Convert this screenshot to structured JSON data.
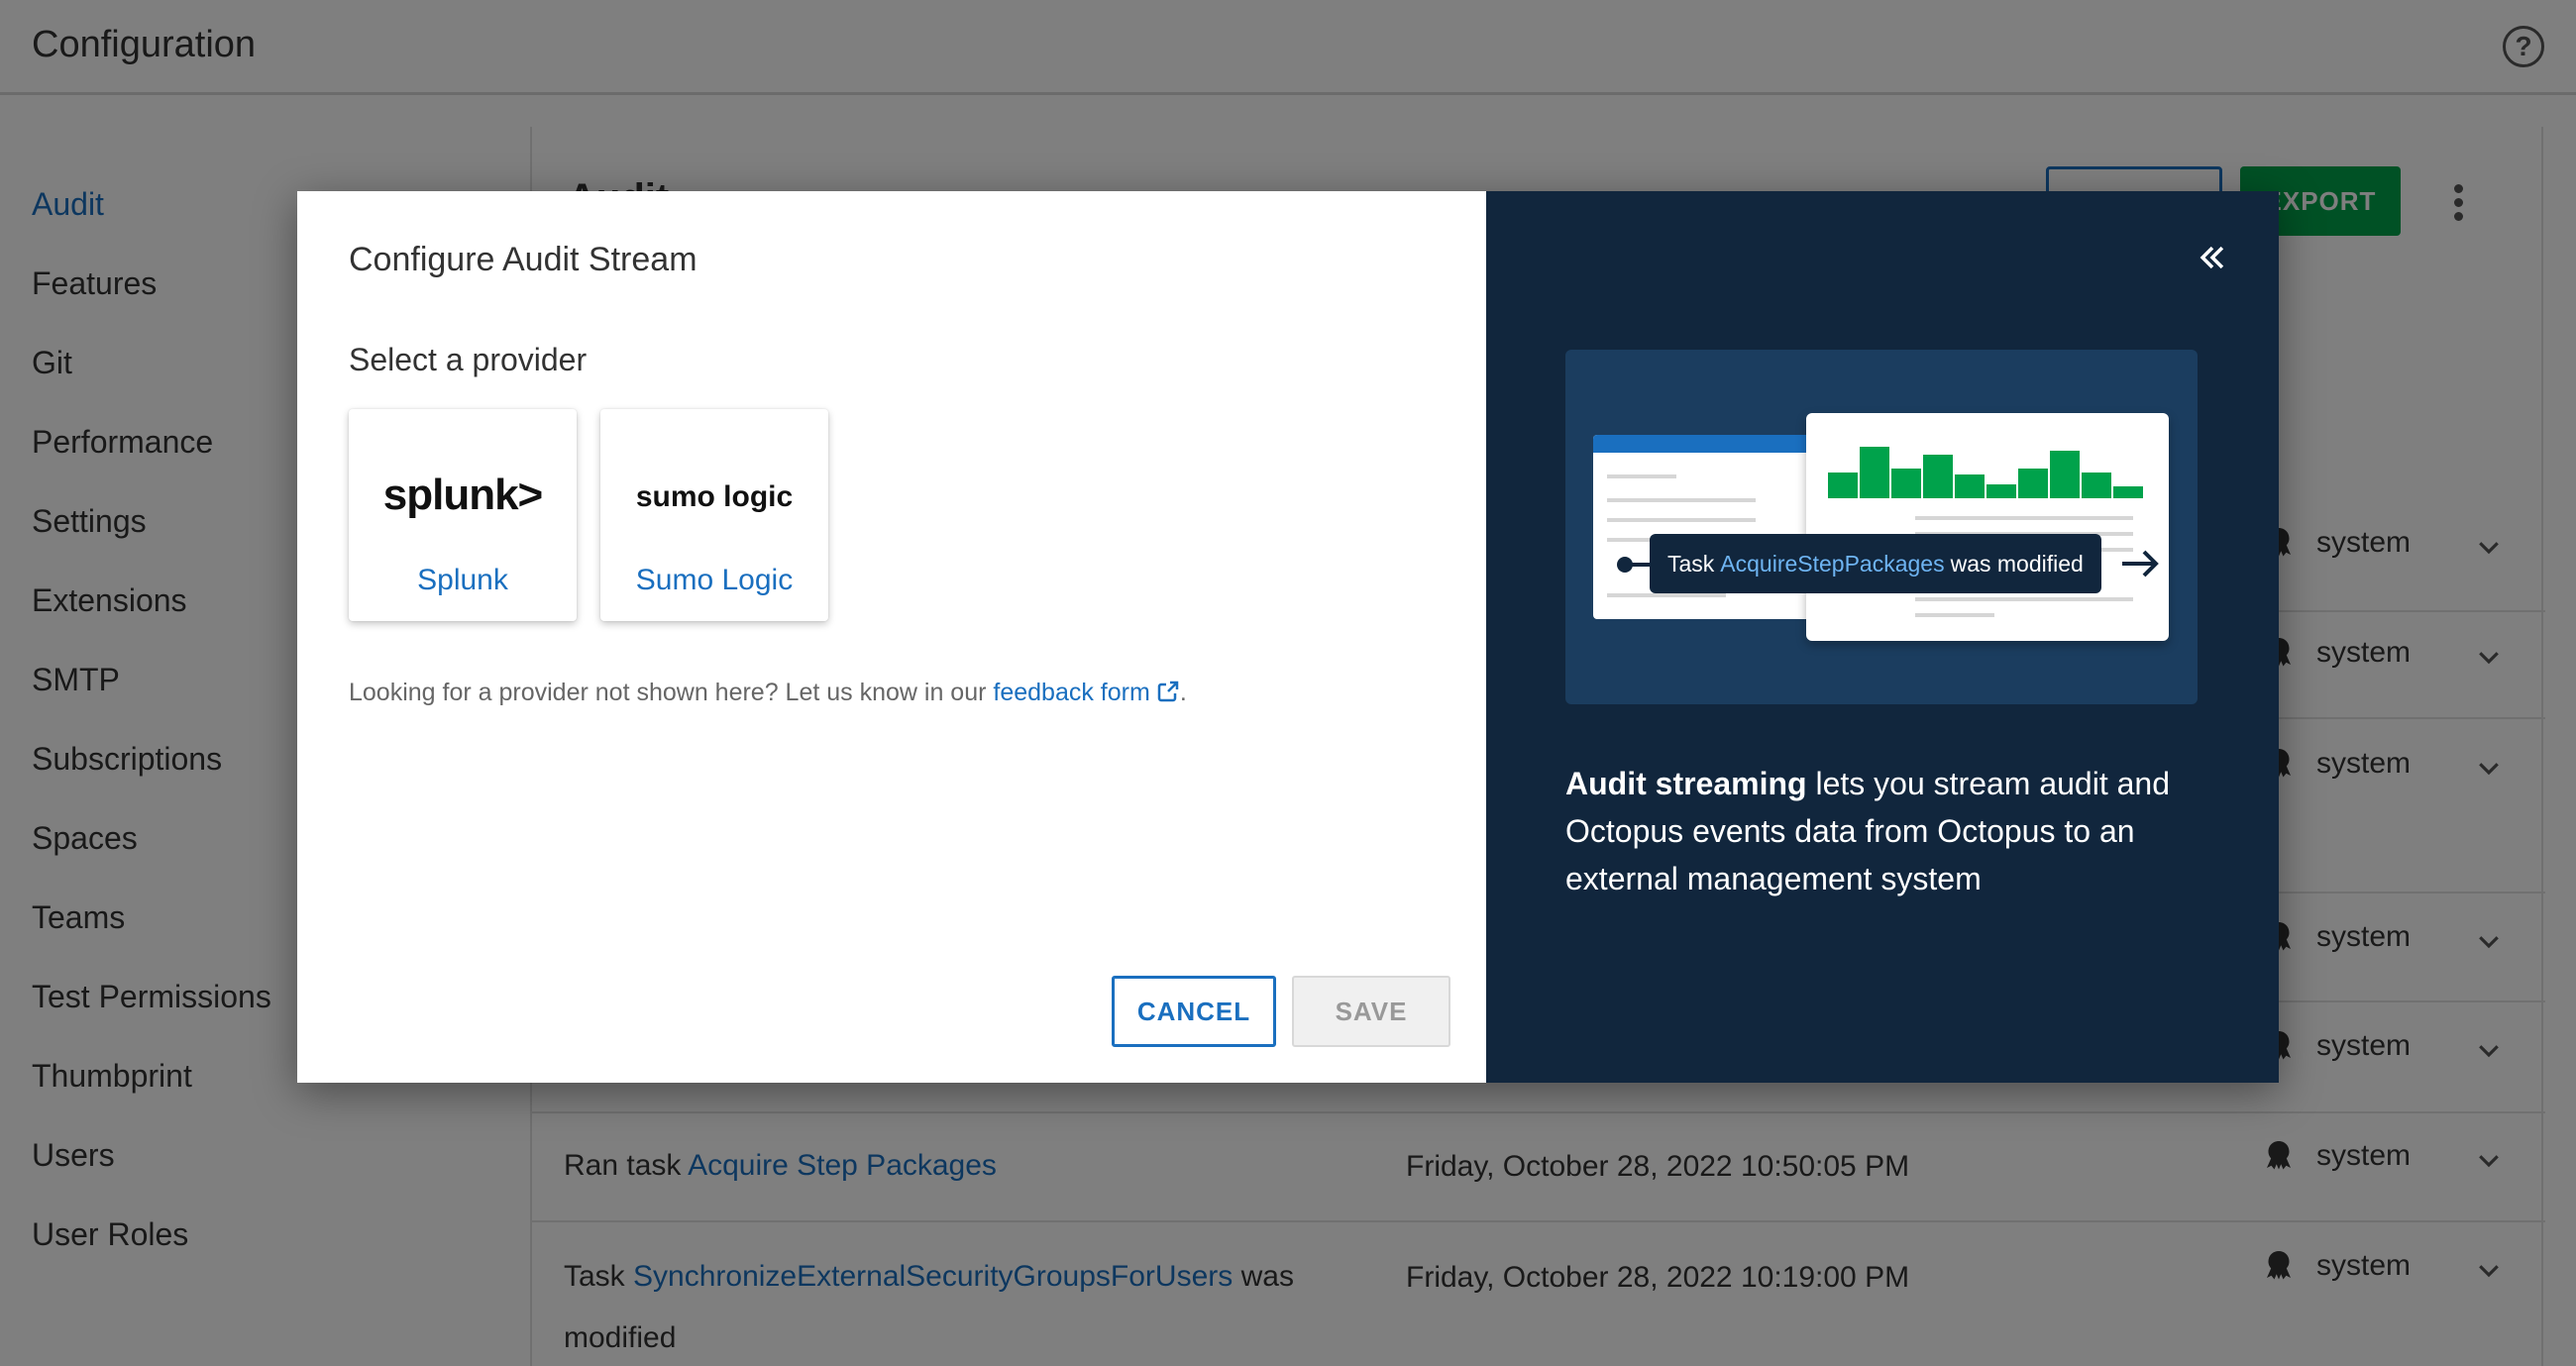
{
  "header": {
    "title": "Configuration"
  },
  "sidebar": {
    "items": [
      {
        "label": "Audit",
        "active": true
      },
      {
        "label": "Features"
      },
      {
        "label": "Git"
      },
      {
        "label": "Performance"
      },
      {
        "label": "Settings"
      },
      {
        "label": "Extensions"
      },
      {
        "label": "SMTP"
      },
      {
        "label": "Subscriptions"
      },
      {
        "label": "Spaces"
      },
      {
        "label": "Teams"
      },
      {
        "label": "Test Permissions"
      },
      {
        "label": "Thumbprint"
      },
      {
        "label": "Users"
      },
      {
        "label": "User Roles"
      }
    ]
  },
  "content": {
    "title_partial": "Audit",
    "export_label": "EXPORT",
    "rows": [
      {
        "user": "system"
      },
      {
        "user": "system"
      },
      {
        "user": "system"
      },
      {
        "user": "system"
      },
      {
        "user": "system"
      },
      {
        "prefix": "Ran task ",
        "link": "Acquire Step Packages",
        "suffix": "",
        "date": "Friday, October 28, 2022 10:50:05 PM",
        "user": "system"
      },
      {
        "prefix": "Task ",
        "link": "SynchronizeExternalSecurityGroupsForUsers",
        "suffix": " was modified",
        "date": "Friday, October 28, 2022 10:19:00 PM",
        "user": "system"
      }
    ]
  },
  "modal": {
    "title": "Configure Audit Stream",
    "subtitle": "Select a provider",
    "providers": [
      {
        "logo": "splunk>",
        "label": "Splunk"
      },
      {
        "logo": "sumo logic",
        "label": "Sumo Logic"
      }
    ],
    "help_prefix": "Looking for a provider not shown here? Let us know in our ",
    "help_link": "feedback form",
    "help_suffix": ".",
    "cancel_label": "CANCEL",
    "save_label": "SAVE",
    "panel": {
      "tooltip_prefix": "Task",
      "tooltip_link": "AcquireStepPackages",
      "tooltip_suffix": "was modified",
      "desc_bold": "Audit streaming",
      "desc_rest": " lets you stream audit and Octopus events data from Octopus to an external management system"
    }
  },
  "colors": {
    "accent": "#1a6fbf",
    "export_green": "#00a24b",
    "panel_bg": "#11263d",
    "illustration_bg": "#1b3d5f"
  }
}
